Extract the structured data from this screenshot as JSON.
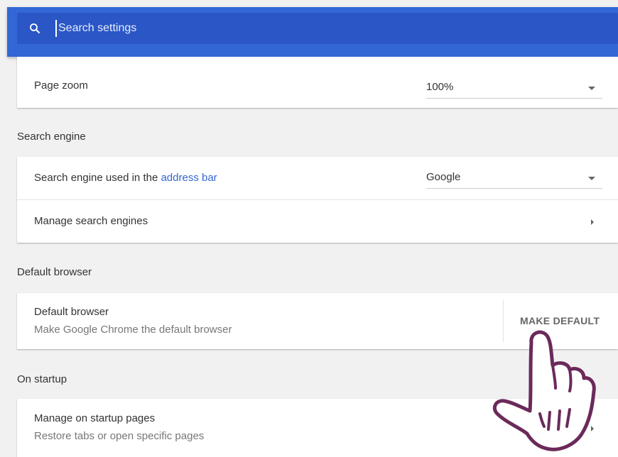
{
  "search": {
    "placeholder": "Search settings",
    "icon": "search-icon"
  },
  "appearance": {
    "page_zoom_label": "Page zoom",
    "page_zoom_value": "100%"
  },
  "search_engine": {
    "section_title": "Search engine",
    "used_label_prefix": "Search engine used in the ",
    "used_label_link": "address bar",
    "engine_value": "Google",
    "manage_label": "Manage search engines"
  },
  "default_browser": {
    "section_title": "Default browser",
    "title": "Default browser",
    "subtitle": "Make Google Chrome the default browser",
    "button_label": "MAKE DEFAULT"
  },
  "on_startup": {
    "section_title": "On startup",
    "manage_label": "Manage on startup pages",
    "manage_sub": "Restore tabs or open specific pages"
  },
  "colors": {
    "header": "#3367d6",
    "search_box": "#2a56c6",
    "link": "#3367d6",
    "background": "#f1f1f1",
    "cursor_outline": "#6b2a5a"
  },
  "overlay": {
    "pointer": "hand-pointer-icon"
  }
}
